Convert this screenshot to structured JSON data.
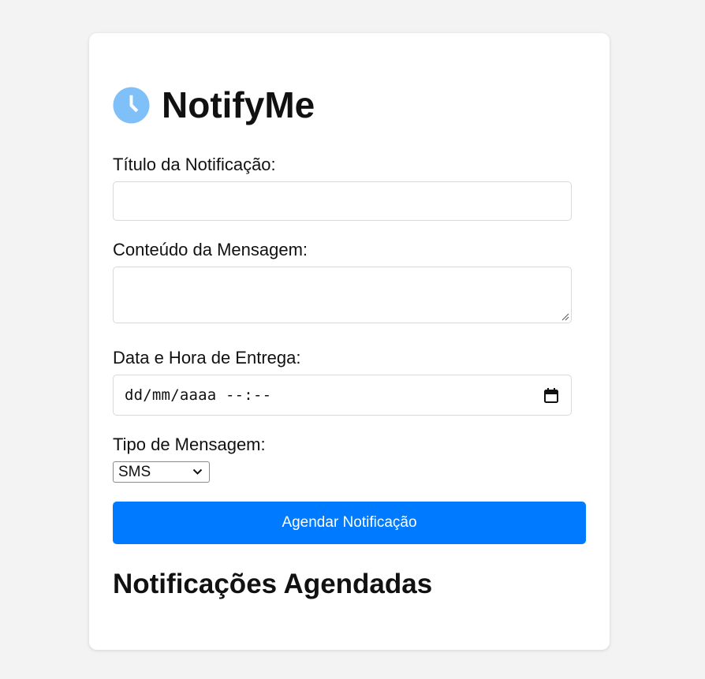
{
  "app": {
    "title": "NotifyMe",
    "icon": "clock-icon",
    "accent": "#007bff",
    "icon_color": "#7fc0f8"
  },
  "form": {
    "title_label": "Título da Notificação:",
    "title_value": "",
    "message_label": "Conteúdo da Mensagem:",
    "message_value": "",
    "datetime_label": "Data e Hora de Entrega:",
    "datetime_placeholder": "dd/mm/aaaa --:--",
    "type_label": "Tipo de Mensagem:",
    "type_selected": "SMS",
    "submit_label": "Agendar Notificação"
  },
  "scheduled": {
    "heading": "Notificações Agendadas",
    "items": []
  }
}
